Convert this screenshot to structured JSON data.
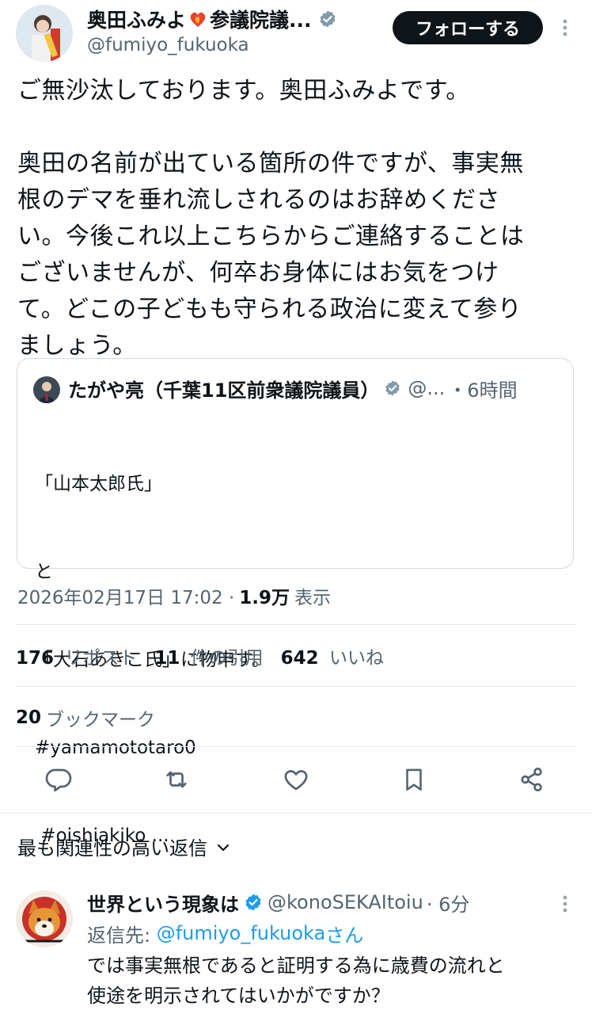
{
  "tweet": {
    "author": {
      "name": "奥田ふみよ",
      "name_suffix": "参議院議...",
      "handle": "@fumiyo_fukuoka",
      "avatar_icon": "politician-avatar"
    },
    "follow_label": "フォローする",
    "body_lines": [
      "ご無沙汰しております。奥田ふみよです。",
      "",
      "奥田の名前が出ている箇所の件ですが、事実無",
      "根のデマを垂れ流しされるのはお辞めくださ",
      "い。今後これ以上こちらからご連絡することは",
      "ございませんが、何卒お身体にはお気をつけ",
      "て。どこの子どもも守られる政治に変えて参り",
      "ましょう。"
    ],
    "quote": {
      "author_name": "たがや亮（千葉11区前衆議院議員）",
      "handle": "@...",
      "time": "・6時間",
      "lines": [
        "「山本太郎氏」",
        "と",
        "「大石あきこ氏」に物申す。",
        "#yamamototaro0",
        " #oishiakiko ..."
      ]
    },
    "timestamp": "2026年02月17日 17:02 ·",
    "views_count": "1.9万",
    "views_label": "表示",
    "stats": {
      "reposts_count": "176",
      "reposts_label": "リポスト",
      "quotes_count": "11",
      "quotes_label": "件の引用",
      "likes_count": "642",
      "likes_label": "いいね",
      "bookmarks_count": "20",
      "bookmarks_label": "ブックマーク"
    }
  },
  "replies_sort_label": "最も関連性の高い返信",
  "reply": {
    "name": "世界という現象は",
    "handle": "@konoSEKAItoiu",
    "time": "· 6分",
    "reply_to_prefix": "返信先: ",
    "reply_to_handle": "@fumiyo_fukuoka",
    "reply_to_suffix": "さん",
    "body_lines": [
      "では事実無根であると証明する為に歳費の流れと",
      "使途を明示されてはいかがですか？"
    ]
  },
  "colors": {
    "text": "#0f1419",
    "muted": "#536471",
    "link": "#1d9bf0",
    "verified": "#1d9bf0",
    "follow_bg": "#0f1419"
  }
}
